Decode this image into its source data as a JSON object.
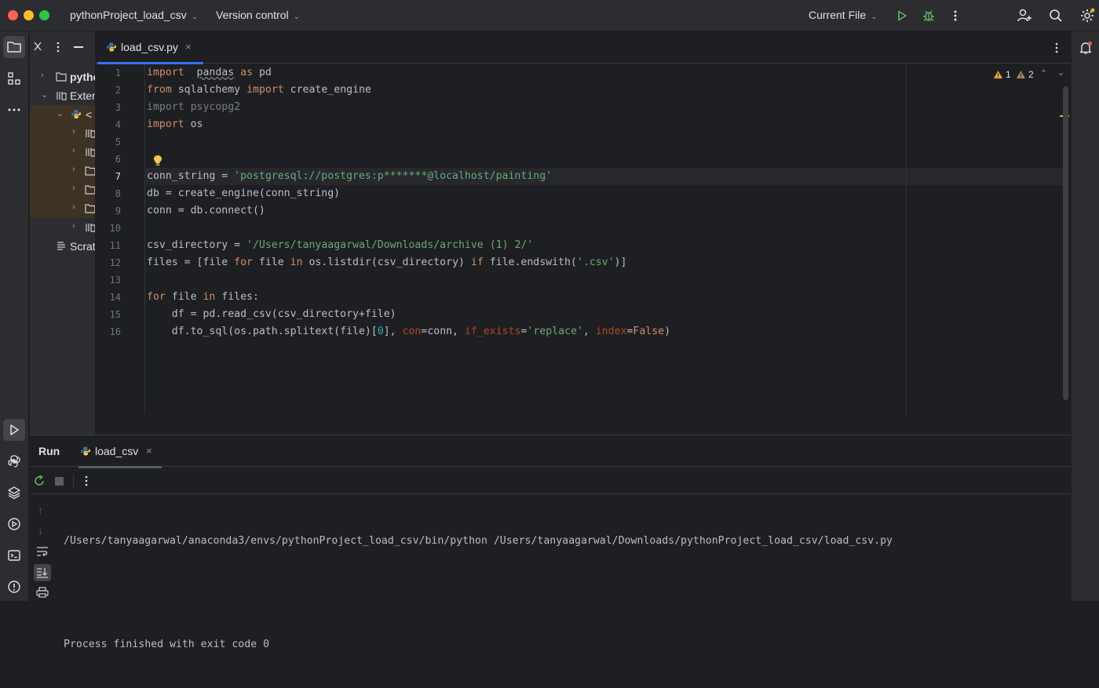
{
  "titlebar": {
    "project_name": "pythonProject_load_csv",
    "version_control": "Version control",
    "run_config": "Current File"
  },
  "project_tree": {
    "items": [
      {
        "label": "pytho"
      },
      {
        "label": "Exter"
      },
      {
        "label": "<"
      },
      {
        "label": "Scrat"
      }
    ]
  },
  "editor": {
    "tab": {
      "label": "load_csv.py"
    },
    "line_numbers": [
      "1",
      "2",
      "3",
      "4",
      "5",
      "6",
      "7",
      "8",
      "9",
      "10",
      "11",
      "12",
      "13",
      "14",
      "15",
      "16"
    ],
    "current_line": 7,
    "inspections": {
      "warnings_a": "1",
      "warnings_b": "2"
    },
    "code": {
      "l1_import": "import",
      "l1_mod": "pandas",
      "l1_as": "as",
      "l1_alias": "pd",
      "l2_from": "from",
      "l2_mod": "sqlalchemy",
      "l2_import": "import",
      "l2_name": "create_engine",
      "l3_text": "import psycopg2",
      "l4_import": "import",
      "l4_mod": "os",
      "l7_var": "conn_string = ",
      "l7_str": "'postgresql://postgres:p*******@localhost/painting'",
      "l8_text": "db = create_engine(conn_string)",
      "l9_text": "conn = db.connect()",
      "l11_var": "csv_directory = ",
      "l11_str": "'/Users/tanyaagarwal/Downloads/archive (1) 2/'",
      "l12_a": "files = [file ",
      "l12_for": "for",
      "l12_b": " file ",
      "l12_in": "in",
      "l12_c": " os.listdir(csv_directory) ",
      "l12_if": "if",
      "l12_d": " file.endswith(",
      "l12_str": "'.csv'",
      "l12_e": ")]",
      "l14_for": "for",
      "l14_a": " file ",
      "l14_in": "in",
      "l14_b": " files:",
      "l15_text": "    df = pd.read_csv(csv_directory+file)",
      "l16_a": "    df.to_sql(os.path.splitext(file)[",
      "l16_num": "0",
      "l16_b": "], ",
      "l16_p1": "con",
      "l16_c": "=conn, ",
      "l16_p2": "if_exists",
      "l16_d": "=",
      "l16_str": "'replace'",
      "l16_e": ", ",
      "l16_p3": "index",
      "l16_f": "=",
      "l16_false": "False",
      "l16_g": ")"
    }
  },
  "run": {
    "title": "Run",
    "tab_label": "load_csv",
    "console": {
      "command": "/Users/tanyaagarwal/anaconda3/envs/pythonProject_load_csv/bin/python /Users/tanyaagarwal/Downloads/pythonProject_load_csv/load_csv.py",
      "result": "Process finished with exit code 0"
    }
  },
  "icons": {
    "close_glyph": "×",
    "chevron": "⌄"
  },
  "colors": {
    "accent": "#3574f0",
    "keyword": "#cf8e6d",
    "string": "#6aab73",
    "warning": "#e5a83b",
    "run_green": "#5fb865"
  }
}
